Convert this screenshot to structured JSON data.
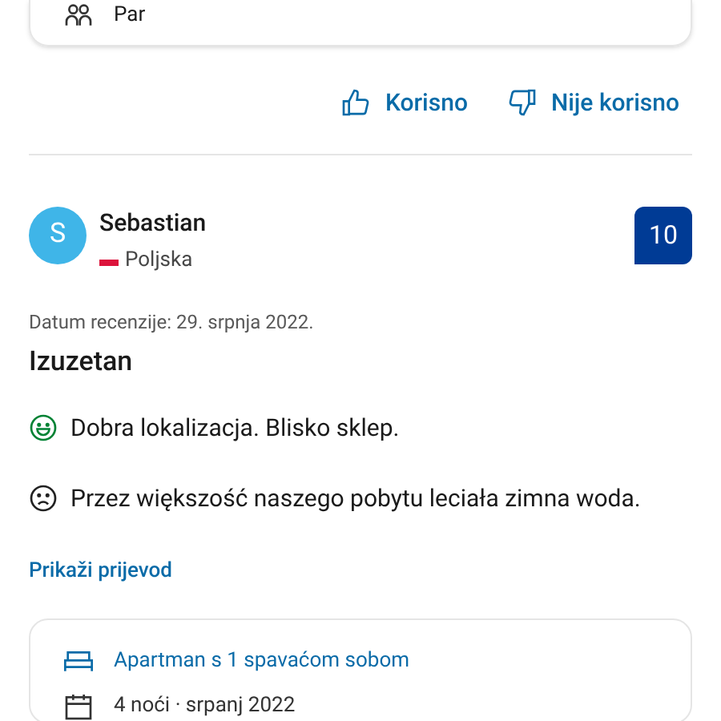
{
  "previous_review": {
    "stay_items": [
      {
        "kind": "guests",
        "text": "Par"
      }
    ],
    "actions": [
      {
        "kind": "helpful",
        "label": "Korisno"
      },
      {
        "kind": "not_helpful",
        "label": "Nije korisno"
      }
    ]
  },
  "review": {
    "avatar_letter": "S",
    "reviewer": "Sebastian",
    "country": "Poljska",
    "score": "10",
    "date": "Datum recenzije: 29. srpnja 2022.",
    "title": "Izuzetan",
    "comments": [
      {
        "kind": "positive",
        "text": "Dobra lokalizacja. Blisko sklep."
      },
      {
        "kind": "negative",
        "text": "Przez większość naszego pobytu leciała zimna woda."
      }
    ],
    "translate_link": "Prikaži prijevod",
    "stay_items": [
      {
        "kind": "room",
        "text": "Apartman s 1 spavaćom sobom"
      },
      {
        "kind": "nights",
        "text": "4 noći · srpanj 2022"
      }
    ]
  }
}
